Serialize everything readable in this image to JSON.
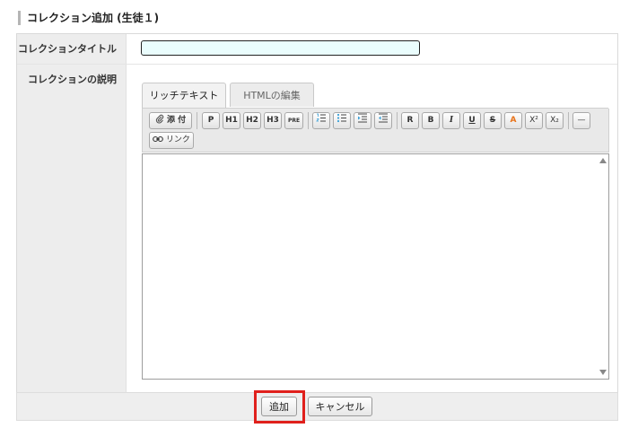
{
  "page": {
    "section_title": "コレクション追加 (生徒１)"
  },
  "form": {
    "title_label": "コレクションタイトル",
    "title_value": "",
    "description_label": "コレクションの説明"
  },
  "editor": {
    "tabs": [
      {
        "label": "リッチテキスト",
        "active": true
      },
      {
        "label": "HTMLの編集",
        "active": false
      }
    ],
    "toolbar": {
      "attach": "添 付",
      "p": "P",
      "h1": "H1",
      "h2": "H2",
      "h3": "H3",
      "pre": "PRE",
      "r": "R",
      "b": "B",
      "i": "I",
      "u": "U",
      "s": "S",
      "a": "A",
      "sup": "X²",
      "sub": "X₂",
      "hr": "—",
      "link": "リンク"
    },
    "content": ""
  },
  "footer": {
    "add_label": "追加",
    "cancel_label": "キャンセル"
  },
  "colors": {
    "highlight": "#e0201c",
    "input_bg": "#eafdfd",
    "label_bg": "#ededed",
    "font_color_icon": "#e8731a"
  }
}
